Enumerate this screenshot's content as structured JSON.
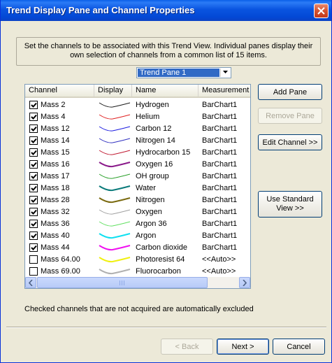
{
  "window": {
    "title": "Trend Display Pane and Channel Properties"
  },
  "intro": "Set the channels to be associated with this Trend View.  Individual panes display their own selection of channels from a common list of 15 items.",
  "pane_select": {
    "value": "Trend Pane 1"
  },
  "list": {
    "columns": [
      "Channel",
      "Display",
      "Name",
      "Measurement"
    ],
    "rows": [
      {
        "channel": "Mass 2",
        "checked": true,
        "name": "Hydrogen",
        "measurement": "BarChart1",
        "color": "#1a1a1a",
        "thick": false
      },
      {
        "channel": "Mass 4",
        "checked": true,
        "name": "Helium",
        "measurement": "BarChart1",
        "color": "#e02020",
        "thick": false
      },
      {
        "channel": "Mass 12",
        "checked": true,
        "name": "Carbon 12",
        "measurement": "BarChart1",
        "color": "#1a1ae0",
        "thick": false
      },
      {
        "channel": "Mass 14",
        "checked": true,
        "name": "Nitrogen 14",
        "measurement": "BarChart1",
        "color": "#3030c0",
        "thick": false
      },
      {
        "channel": "Mass 15",
        "checked": true,
        "name": "Hydrocarbon 15",
        "measurement": "BarChart1",
        "color": "#c01830",
        "thick": false
      },
      {
        "channel": "Mass 16",
        "checked": true,
        "name": "Oxygen 16",
        "measurement": "BarChart1",
        "color": "#8a1a8a",
        "thick": true
      },
      {
        "channel": "Mass 17",
        "checked": true,
        "name": "OH group",
        "measurement": "BarChart1",
        "color": "#2aa02a",
        "thick": false
      },
      {
        "channel": "Mass 18",
        "checked": true,
        "name": "Water",
        "measurement": "BarChart1",
        "color": "#0a7a7a",
        "thick": true
      },
      {
        "channel": "Mass 28",
        "checked": true,
        "name": "Nitrogen",
        "measurement": "BarChart1",
        "color": "#7a6a10",
        "thick": true
      },
      {
        "channel": "Mass 32",
        "checked": true,
        "name": "Oxygen",
        "measurement": "BarChart1",
        "color": "#a0a0a0",
        "thick": false
      },
      {
        "channel": "Mass 36",
        "checked": true,
        "name": "Argon 36",
        "measurement": "BarChart1",
        "color": "#60e060",
        "thick": false
      },
      {
        "channel": "Mass 40",
        "checked": true,
        "name": "Argon",
        "measurement": "BarChart1",
        "color": "#10e0f0",
        "thick": true
      },
      {
        "channel": "Mass 44",
        "checked": true,
        "name": "Carbon dioxide",
        "measurement": "BarChart1",
        "color": "#f010f0",
        "thick": true
      },
      {
        "channel": "Mass 64.00",
        "checked": false,
        "name": "Photoresist 64",
        "measurement": "<<Auto>>",
        "color": "#f0f010",
        "thick": true
      },
      {
        "channel": "Mass 69.00",
        "checked": false,
        "name": "Fluorocarbon",
        "measurement": "<<Auto>>",
        "color": "#b0b0b0",
        "thick": true
      }
    ]
  },
  "side_buttons": {
    "add_pane": "Add Pane",
    "remove_pane": "Remove Pane",
    "edit_channel": "Edit Channel >>",
    "use_standard_view_line1": "Use Standard",
    "use_standard_view_line2": "View >>"
  },
  "note": "Checked channels that are not acquired are automatically excluded",
  "footer": {
    "back": "< Back",
    "next": "Next >",
    "cancel": "Cancel"
  }
}
